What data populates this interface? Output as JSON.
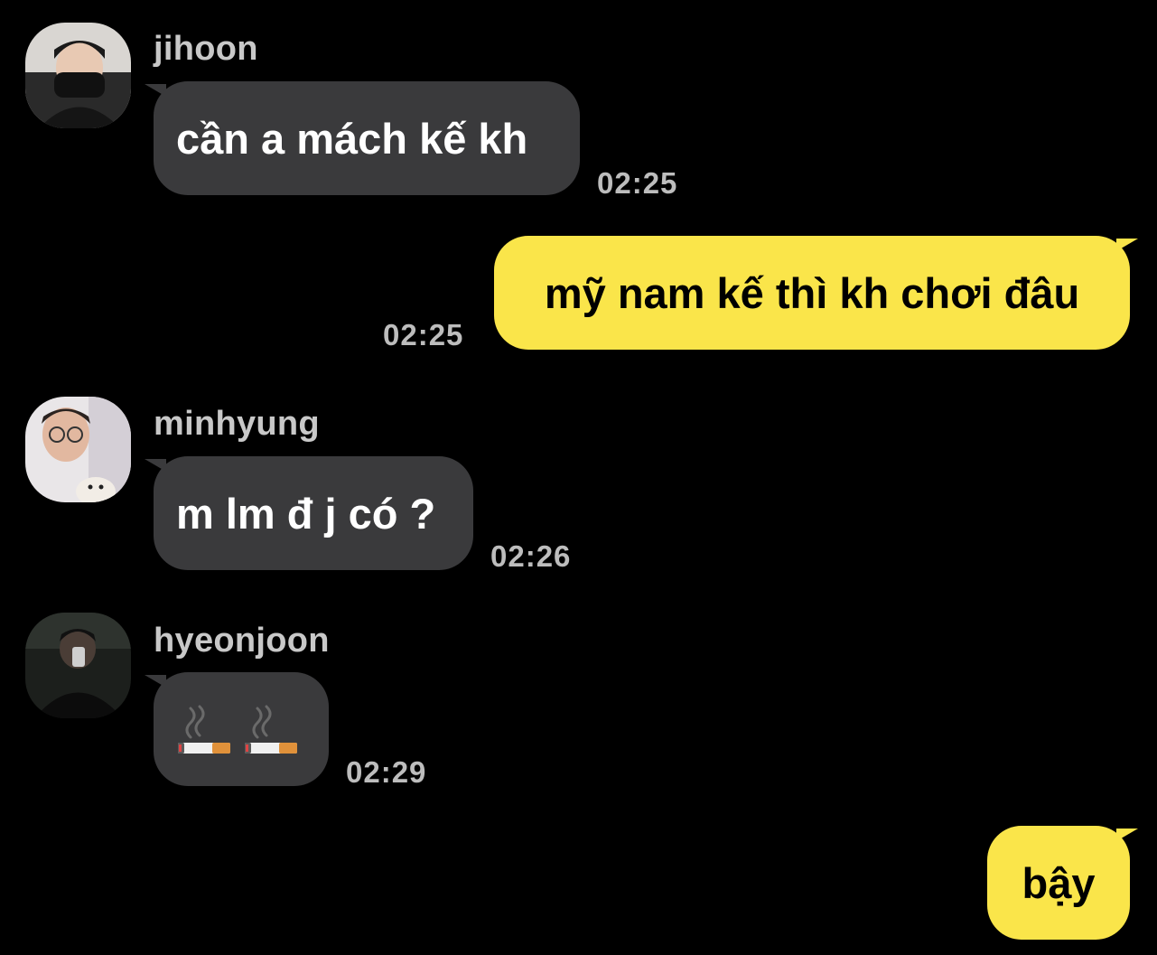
{
  "messages": [
    {
      "sender": "jihoon",
      "text": "cần a mách kế kh",
      "time": "02:25"
    },
    {
      "sender": "me",
      "text": "mỹ nam kế thì kh chơi đâu",
      "time": "02:25"
    },
    {
      "sender": "minhyung",
      "text": "m lm đ j có ?",
      "time": "02:26"
    },
    {
      "sender": "hyeonjoon",
      "emojis": [
        "cigarette-emoji",
        "cigarette-emoji"
      ],
      "time": "02:29"
    },
    {
      "sender": "me",
      "text": "bậy"
    }
  ],
  "colors": {
    "background": "#000000",
    "incoming_bubble": "#3a3a3c",
    "outgoing_bubble": "#fae54a",
    "sender_name": "#c8c8c8",
    "timestamp": "#bdbdbd"
  }
}
